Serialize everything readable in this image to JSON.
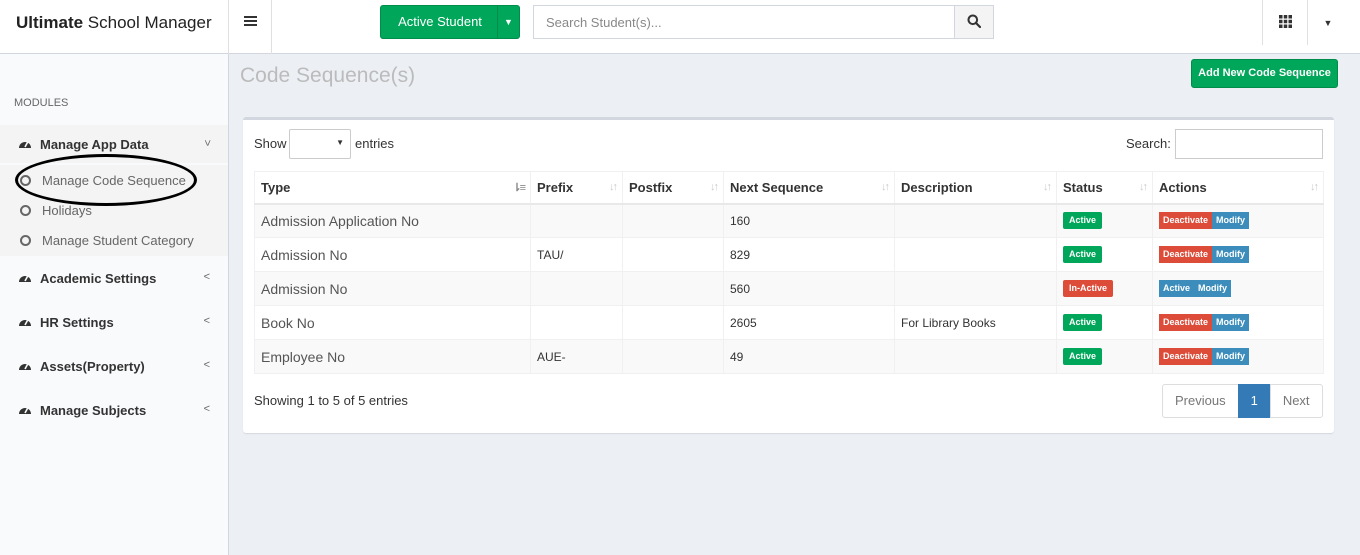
{
  "header": {
    "logo_bold": "Ultimate",
    "logo_rest": " School Manager",
    "active_student_label": "Active Student",
    "search_placeholder": "Search Student(s)..."
  },
  "sidebar": {
    "modules_header": "MODULES",
    "items": [
      {
        "label": "Manage App Data",
        "icon": "dashboard-icon",
        "open": true
      },
      {
        "label": "Academic Settings",
        "icon": "dashboard-icon"
      },
      {
        "label": "HR Settings",
        "icon": "dashboard-icon"
      },
      {
        "label": "Assets(Property)",
        "icon": "dashboard-icon"
      },
      {
        "label": "Manage Subjects",
        "icon": "dashboard-icon"
      }
    ],
    "subitems": [
      {
        "label": "Manage Code Sequence"
      },
      {
        "label": "Holidays"
      },
      {
        "label": "Manage Student Category"
      }
    ]
  },
  "main": {
    "title": "Code Sequence(s)",
    "add_button": "Add New Code Sequence",
    "show_label": "Show",
    "entries_label": "entries",
    "search_label": "Search:",
    "columns": [
      "Type",
      "Prefix",
      "Postfix",
      "Next Sequence",
      "Description",
      "Status",
      "Actions"
    ],
    "rows": [
      {
        "type": "Admission Application No",
        "prefix": "",
        "postfix": "",
        "next": "160",
        "description": "",
        "status": "Active",
        "action1": "Deactivate",
        "action2": "Modify"
      },
      {
        "type": "Admission No",
        "prefix": "TAU/",
        "postfix": "",
        "next": "829",
        "description": "",
        "status": "Active",
        "action1": "Deactivate",
        "action2": "Modify"
      },
      {
        "type": "Admission No",
        "prefix": "",
        "postfix": "",
        "next": "560",
        "description": "",
        "status": "In-Active",
        "action1": "Active",
        "action2": "Modify"
      },
      {
        "type": "Book No",
        "prefix": "",
        "postfix": "",
        "next": "2605",
        "description": "For Library Books",
        "status": "Active",
        "action1": "Deactivate",
        "action2": "Modify"
      },
      {
        "type": "Employee No",
        "prefix": "AUE-",
        "postfix": "",
        "next": "49",
        "description": "",
        "status": "Active",
        "action1": "Deactivate",
        "action2": "Modify"
      }
    ],
    "info": "Showing 1 to 5 of 5 entries",
    "pagination": {
      "previous": "Previous",
      "current": "1",
      "next": "Next"
    }
  },
  "colors": {
    "green": "#00a65a",
    "red": "#dd4b39",
    "blue": "#3c8dbc",
    "page_blue": "#337ab7"
  }
}
